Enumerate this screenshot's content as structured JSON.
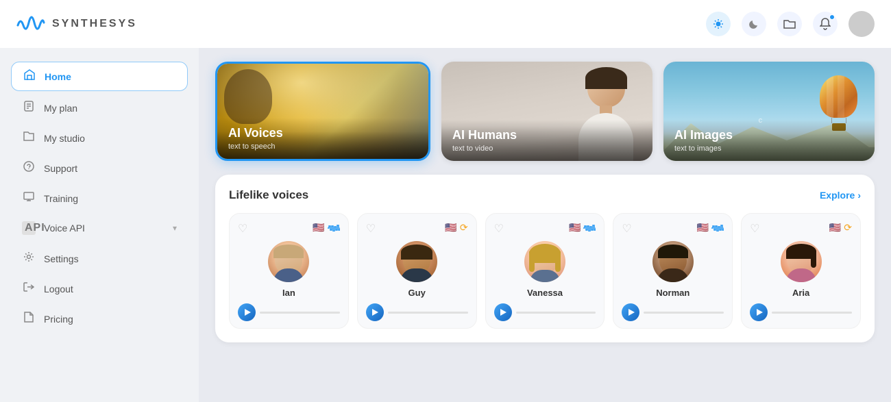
{
  "header": {
    "logo_text": "SYNTHESYS",
    "icons": {
      "sun": "☀",
      "moon": "🌙",
      "folder": "🗂",
      "bell": "🔔"
    }
  },
  "sidebar": {
    "items": [
      {
        "id": "home",
        "label": "Home",
        "icon": "⌂",
        "active": true
      },
      {
        "id": "my-plan",
        "label": "My plan",
        "icon": "📄",
        "active": false
      },
      {
        "id": "my-studio",
        "label": "My studio",
        "icon": "📁",
        "active": false
      },
      {
        "id": "support",
        "label": "Support",
        "icon": "❓",
        "active": false
      },
      {
        "id": "training",
        "label": "Training",
        "icon": "🖥",
        "active": false
      },
      {
        "id": "voice-api",
        "label": "Voice API",
        "icon": "API",
        "active": false,
        "hasChevron": true
      },
      {
        "id": "settings",
        "label": "Settings",
        "icon": "⚙",
        "active": false
      },
      {
        "id": "logout",
        "label": "Logout",
        "icon": "→",
        "active": false
      },
      {
        "id": "pricing",
        "label": "Pricing",
        "icon": "🏷",
        "active": false
      }
    ]
  },
  "feature_cards": [
    {
      "id": "ai-voices",
      "title": "AI Voices",
      "subtitle": "text to speech",
      "selected": true,
      "type": "voices"
    },
    {
      "id": "ai-humans",
      "title": "AI Humans",
      "subtitle": "text to video",
      "selected": false,
      "type": "humans"
    },
    {
      "id": "ai-images",
      "title": "AI Images",
      "subtitle": "text to images",
      "selected": false,
      "type": "images"
    }
  ],
  "voices_section": {
    "title": "Lifelike voices",
    "explore_label": "Explore",
    "explore_arrow": "›",
    "voices": [
      {
        "id": "ian",
        "name": "Ian",
        "flag": "🇺🇸",
        "icon_type": "waveform",
        "color": "blue"
      },
      {
        "id": "guy",
        "name": "Guy",
        "flag": "🇺🇸",
        "icon_type": "loop",
        "color": "orange"
      },
      {
        "id": "vanessa",
        "name": "Vanessa",
        "flag": "🇺🇸",
        "icon_type": "waveform",
        "color": "blue"
      },
      {
        "id": "norman",
        "name": "Norman",
        "flag": "🇺🇸",
        "icon_type": "waveform",
        "color": "blue"
      },
      {
        "id": "aria",
        "name": "Aria",
        "flag": "🇺🇸",
        "icon_type": "loop",
        "color": "orange"
      }
    ]
  }
}
